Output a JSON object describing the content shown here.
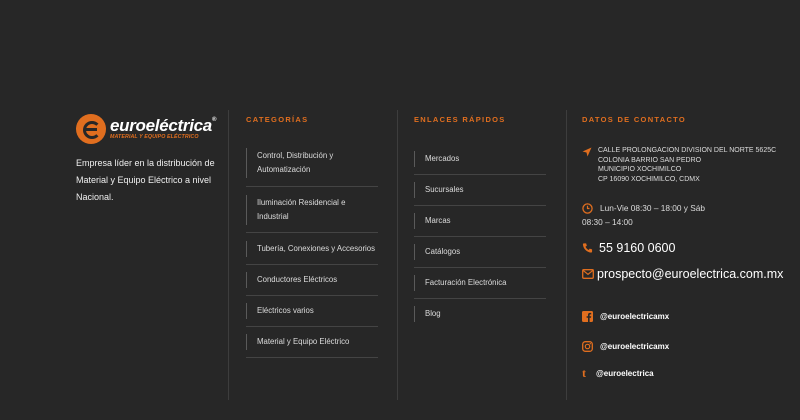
{
  "brand": {
    "logo_word": "euroeléctrica",
    "logo_reg": "®",
    "logo_sub": "MATERIAL Y EQUIPO ELÉCTRICO",
    "description": "Empresa líder en la distribución de Material y Equipo Eléctrico a nivel Nacional."
  },
  "categories": {
    "heading": "CATEGORÍAS",
    "items": [
      {
        "label": "Control, Distribución y Automatización"
      },
      {
        "label": "Iluminación Residencial e Industrial"
      },
      {
        "label": "Tubería, Conexiones y Accesorios"
      },
      {
        "label": "Conductores Eléctricos"
      },
      {
        "label": "Eléctricos varios"
      },
      {
        "label": "Material y Equipo Eléctrico"
      }
    ]
  },
  "quick_links": {
    "heading": "ENLACES RÁPIDOS",
    "items": [
      {
        "label": "Mercados"
      },
      {
        "label": "Sucursales"
      },
      {
        "label": "Marcas"
      },
      {
        "label": "Catálogos"
      },
      {
        "label": "Facturación Electrónica"
      },
      {
        "label": "Blog"
      }
    ]
  },
  "contact": {
    "heading": "DATOS DE CONTACTO",
    "address_lines": [
      "CALLE PROLONGACION DIVISION DEL NORTE 5625C",
      "COLONIA BARRIO SAN PEDRO",
      "MUNICIPIO XOCHIMILCO",
      "CP 16090  XOCHIMILCO, CDMX"
    ],
    "hours_line1": "Lun-Vie 08:30 – 18:00 y Sáb",
    "hours_line2": "08:30 – 14:00",
    "phone": "55 9160 0600",
    "email": "prospecto@euroelectrica.com.mx",
    "social": [
      {
        "icon": "facebook-icon",
        "label": "@euroelectricamx"
      },
      {
        "icon": "instagram-icon",
        "label": "@euroelectricamx"
      },
      {
        "icon": "tumblr-icon",
        "label": "@euroelectrica"
      }
    ]
  },
  "colors": {
    "background": "#272727",
    "accent": "#e06e1f",
    "text": "#e8e8e8"
  }
}
